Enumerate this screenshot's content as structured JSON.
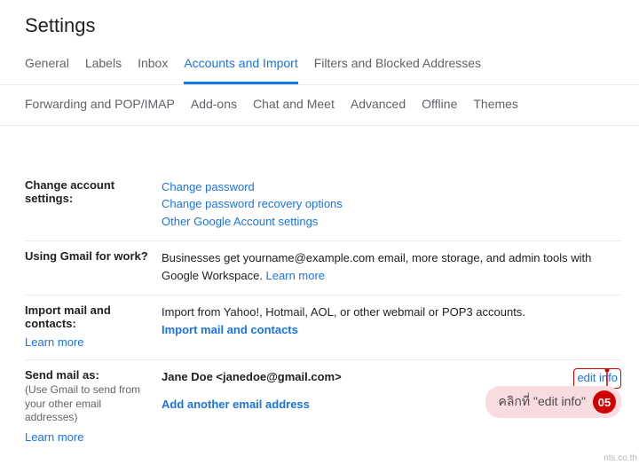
{
  "page": {
    "title": "Settings"
  },
  "tabs": {
    "row1": [
      {
        "label": "General"
      },
      {
        "label": "Labels"
      },
      {
        "label": "Inbox"
      },
      {
        "label": "Accounts and Import",
        "active": true
      },
      {
        "label": "Filters and Blocked Addresses"
      }
    ],
    "row2": [
      {
        "label": "Forwarding and POP/IMAP"
      },
      {
        "label": "Add-ons"
      },
      {
        "label": "Chat and Meet"
      },
      {
        "label": "Advanced"
      },
      {
        "label": "Offline"
      },
      {
        "label": "Themes"
      }
    ]
  },
  "sections": {
    "changeAccount": {
      "label": "Change account settings:",
      "links": {
        "changePassword": "Change password",
        "recovery": "Change password recovery options",
        "other": "Other Google Account settings"
      }
    },
    "workGmail": {
      "label": "Using Gmail for work?",
      "text": "Businesses get yourname@example.com email, more storage, and admin tools with Google Workspace. ",
      "learn": "Learn more"
    },
    "importMail": {
      "label": "Import mail and contacts:",
      "learnBelow": "Learn more",
      "text": "Import from Yahoo!, Hotmail, AOL, or other webmail or POP3 accounts.",
      "action": "Import mail and contacts"
    },
    "sendAs": {
      "label": "Send mail as:",
      "sub": "(Use Gmail to send from your other email addresses)",
      "learnBelow": "Learn more",
      "identity": "Jane Doe <janedoe@gmail.com>",
      "editInfo": "edit info",
      "addAnother": "Add another email address"
    }
  },
  "annotation": {
    "text": "คลิกที่ \"edit info\"",
    "badge": "05"
  },
  "watermark": "nts.co.th"
}
